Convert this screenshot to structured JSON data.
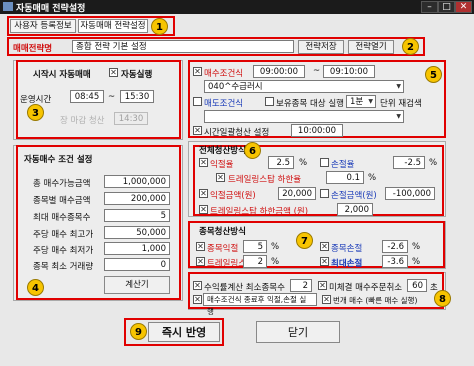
{
  "window": {
    "title": "자동매매 전략설정",
    "min": "–",
    "max": "□",
    "close": "✕"
  },
  "tabs": [
    {
      "label": "사용자 등록정보"
    },
    {
      "label": "자동매매 전략설정"
    }
  ],
  "strategy": {
    "name_label": "매매전략명",
    "name_value": "종합 전략 기본 설정",
    "save_label": "전략저장",
    "open_label": "전략열기"
  },
  "start": {
    "title": "시작시 자동매매",
    "auto_label": "자동실행",
    "time_label": "운영시간",
    "time_from": "08:45",
    "time_sep": "~",
    "time_to": "15:30",
    "disabled_label": "장 마감 청산",
    "disabled_time": "14:30"
  },
  "buy": {
    "title": "자동매수 조건 설정",
    "rows": [
      {
        "label": "총 매수가능금액",
        "value": "1,000,000"
      },
      {
        "label": "종목별 매수금액",
        "value": "200,000"
      },
      {
        "label": "최대 매수종목수",
        "value": "5"
      },
      {
        "label": "주당 매수 최고가",
        "value": "50,000"
      },
      {
        "label": "주당 매수 최저가",
        "value": "1,000"
      },
      {
        "label": "종목 최소 거래량",
        "value": "0"
      }
    ],
    "calc_label": "계산기"
  },
  "cond": {
    "buy_cond_label": "매수조건식",
    "buy_from": "09:00:00",
    "buy_sep": "~",
    "buy_to": "09:10:00",
    "buy_select": "040^수급러시",
    "sell_cond_label": "매도조건식",
    "hold_label": "보유종목 대상 실행",
    "unit_value": "1분",
    "unit_label": "단위 재검색",
    "timeclear_label": "시간일괄청산 설정",
    "timeclear_value": "10:00:00"
  },
  "overall": {
    "title": "전체청산방식",
    "profit_label": "익절율",
    "profit_value": "2.5",
    "profit_unit": "%",
    "loss_label": "손절율",
    "loss_value": "-2.5",
    "loss_unit": "%",
    "trail_label": "트레일링스탑 하한율",
    "trail_value": "0.1",
    "trail_unit": "%",
    "profit_amt_label": "익절금액(원)",
    "profit_amt_value": "20,000",
    "loss_amt_label": "손절금액(원)",
    "loss_amt_value": "-100,000",
    "trail_amt_label": "트레일링스탑 하한금액 (원)",
    "trail_amt_value": "2,000"
  },
  "stock": {
    "title": "종목청산방식",
    "profit_label": "종목익절",
    "profit_value": "5",
    "profit_unit": "%",
    "loss_label": "종목손절",
    "loss_value": "-2.6",
    "loss_unit": "%",
    "trail_label": "트레일링스",
    "trail_value": "2",
    "trail_unit": "%",
    "maxloss_label": "최대손절",
    "maxloss_value": "-3.6",
    "maxloss_unit": "%"
  },
  "extra": {
    "fee_label": "수익률계산 최소종목수",
    "fee_value": "2",
    "unfilled_label": "미체결 매수주문취소",
    "unfilled_value": "60",
    "unfilled_unit": "초",
    "exit_label": "매수조건식 종료후 익절,손절 실행",
    "repeat_label": "번개 매수 (빠른 매수 실행)"
  },
  "footer": {
    "apply_label": "즉시 반영",
    "close_label": "닫기"
  },
  "badges": [
    "1",
    "2",
    "3",
    "4",
    "5",
    "6",
    "7",
    "8",
    "9"
  ],
  "colors": {
    "highlight": "#e00000",
    "badge": "#f7c400",
    "title_bar": "#1b1b1b"
  }
}
